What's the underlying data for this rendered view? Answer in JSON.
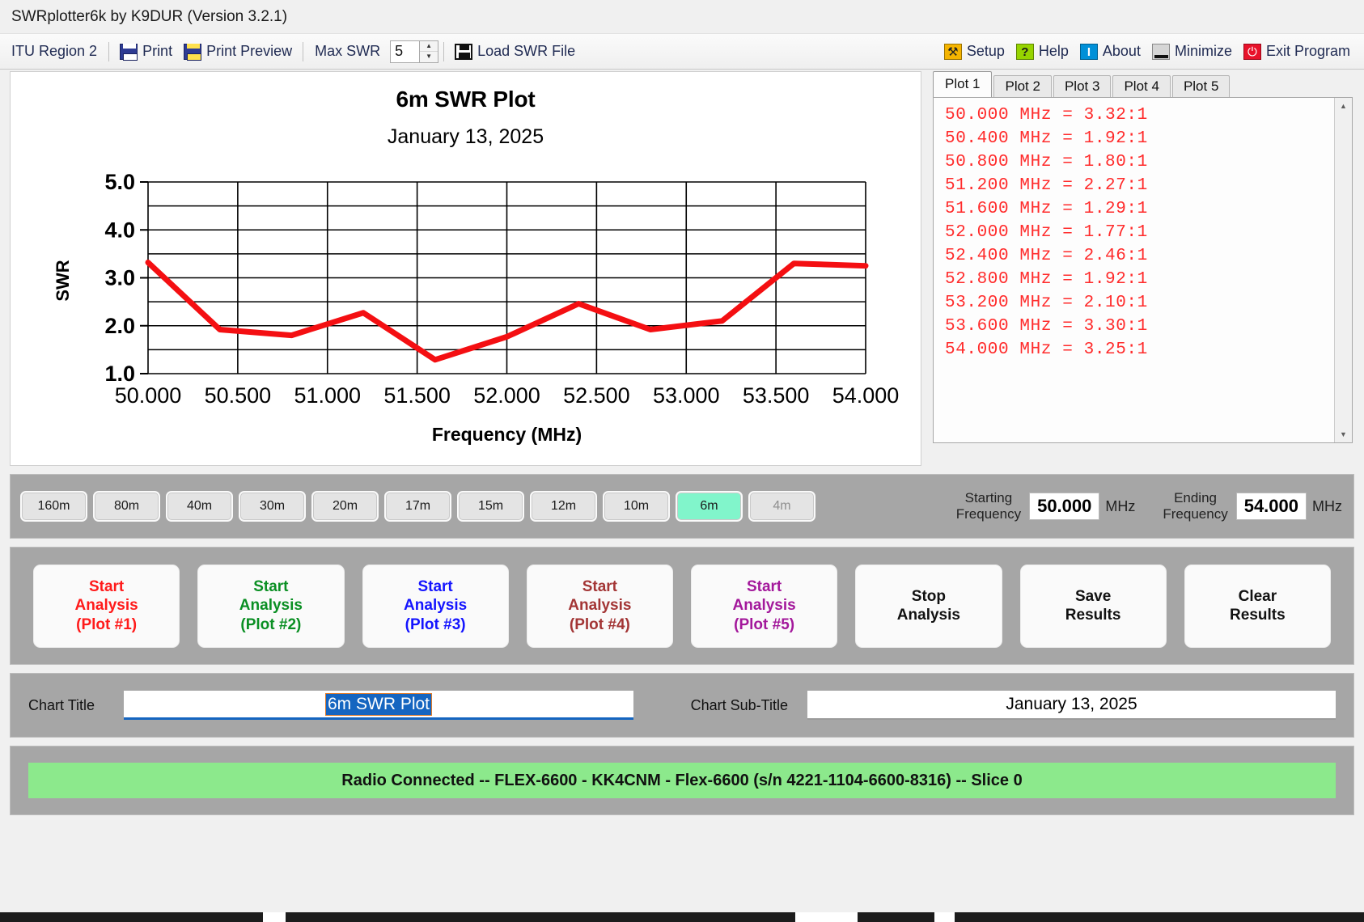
{
  "window": {
    "title": "SWRplotter6k by K9DUR (Version 3.2.1)"
  },
  "toolbar": {
    "itu_region": "ITU Region 2",
    "print": "Print",
    "print_preview": "Print Preview",
    "max_swr_label": "Max SWR",
    "max_swr_value": "5",
    "load_swr_file": "Load SWR File",
    "setup": "Setup",
    "help": "Help",
    "about": "About",
    "minimize": "Minimize",
    "exit": "Exit Program",
    "help_glyph": "?",
    "about_glyph": "I",
    "exit_glyph": "⏻",
    "spin_up": "▲",
    "spin_down": "▼"
  },
  "chart_data": {
    "type": "line",
    "title": "6m SWR Plot",
    "subtitle": "January 13, 2025",
    "xlabel": "Frequency (MHz)",
    "ylabel": "SWR",
    "xlim": [
      50.0,
      54.0
    ],
    "ylim": [
      1.0,
      5.0
    ],
    "xticks": [
      "50.000",
      "50.500",
      "51.000",
      "51.500",
      "52.000",
      "52.500",
      "53.000",
      "53.500",
      "54.000"
    ],
    "yticks": [
      "5.0",
      "4.0",
      "3.0",
      "2.0",
      "1.0"
    ],
    "grid": true,
    "minor_grid_step": 0.5,
    "legend": "none",
    "line_color": "#f40f12",
    "x": [
      50.0,
      50.4,
      50.8,
      51.2,
      51.6,
      52.0,
      52.4,
      52.8,
      53.2,
      53.6,
      54.0
    ],
    "values": [
      3.32,
      1.92,
      1.8,
      2.27,
      1.29,
      1.77,
      2.46,
      1.92,
      2.1,
      3.3,
      3.25
    ]
  },
  "side_panel": {
    "tabs": [
      {
        "label": "Plot 1",
        "active": true
      },
      {
        "label": "Plot 2",
        "active": false
      },
      {
        "label": "Plot 3",
        "active": false
      },
      {
        "label": "Plot 4",
        "active": false
      },
      {
        "label": "Plot 5",
        "active": false
      }
    ],
    "readout_color": "#ff2b2b",
    "readout": [
      "50.000 MHz = 3.32:1",
      "50.400 MHz = 1.92:1",
      "50.800 MHz = 1.80:1",
      "51.200 MHz = 2.27:1",
      "51.600 MHz = 1.29:1",
      "52.000 MHz = 1.77:1",
      "52.400 MHz = 2.46:1",
      "52.800 MHz = 1.92:1",
      "53.200 MHz = 2.10:1",
      "53.600 MHz = 3.30:1",
      "54.000 MHz = 3.25:1"
    ],
    "scroll_up": "▲",
    "scroll_down": "▼"
  },
  "bands": [
    {
      "label": "160m",
      "state": "normal"
    },
    {
      "label": "80m",
      "state": "normal"
    },
    {
      "label": "40m",
      "state": "normal"
    },
    {
      "label": "30m",
      "state": "normal"
    },
    {
      "label": "20m",
      "state": "normal"
    },
    {
      "label": "17m",
      "state": "normal"
    },
    {
      "label": "15m",
      "state": "normal"
    },
    {
      "label": "12m",
      "state": "normal"
    },
    {
      "label": "10m",
      "state": "normal"
    },
    {
      "label": "6m",
      "state": "active"
    },
    {
      "label": "4m",
      "state": "disabled"
    }
  ],
  "frequency": {
    "start_label_line1": "Starting",
    "start_label_line2": "Frequency",
    "start_value": "50.000",
    "start_unit": "MHz",
    "end_label_line1": "Ending",
    "end_label_line2": "Frequency",
    "end_value": "54.000",
    "end_unit": "MHz"
  },
  "analysis_buttons": [
    {
      "line1": "Start",
      "line2": "Analysis",
      "line3": "(Plot #1)",
      "color": "#ff1a1a"
    },
    {
      "line1": "Start",
      "line2": "Analysis",
      "line3": "(Plot #2)",
      "color": "#0a8f23"
    },
    {
      "line1": "Start",
      "line2": "Analysis",
      "line3": "(Plot #3)",
      "color": "#1414ff"
    },
    {
      "line1": "Start",
      "line2": "Analysis",
      "line3": "(Plot #4)",
      "color": "#a33535"
    },
    {
      "line1": "Start",
      "line2": "Analysis",
      "line3": "(Plot #5)",
      "color": "#a3189b"
    },
    {
      "line1": "Stop",
      "line2": "Analysis",
      "line3": "",
      "color": "#111111"
    },
    {
      "line1": "Save",
      "line2": "Results",
      "line3": "",
      "color": "#111111"
    },
    {
      "line1": "Clear",
      "line2": "Results",
      "line3": "",
      "color": "#111111"
    }
  ],
  "title_fields": {
    "chart_title_label": "Chart Title",
    "chart_title_value": "6m SWR Plot",
    "chart_subtitle_label": "Chart Sub-Title",
    "chart_subtitle_value": "January 13, 2025"
  },
  "status": {
    "message": "Radio Connected -- FLEX-6600 - KK4CNM - Flex-6600  (s/n 4221-1104-6600-8316) -- Slice 0",
    "color": "#8ce98c"
  }
}
